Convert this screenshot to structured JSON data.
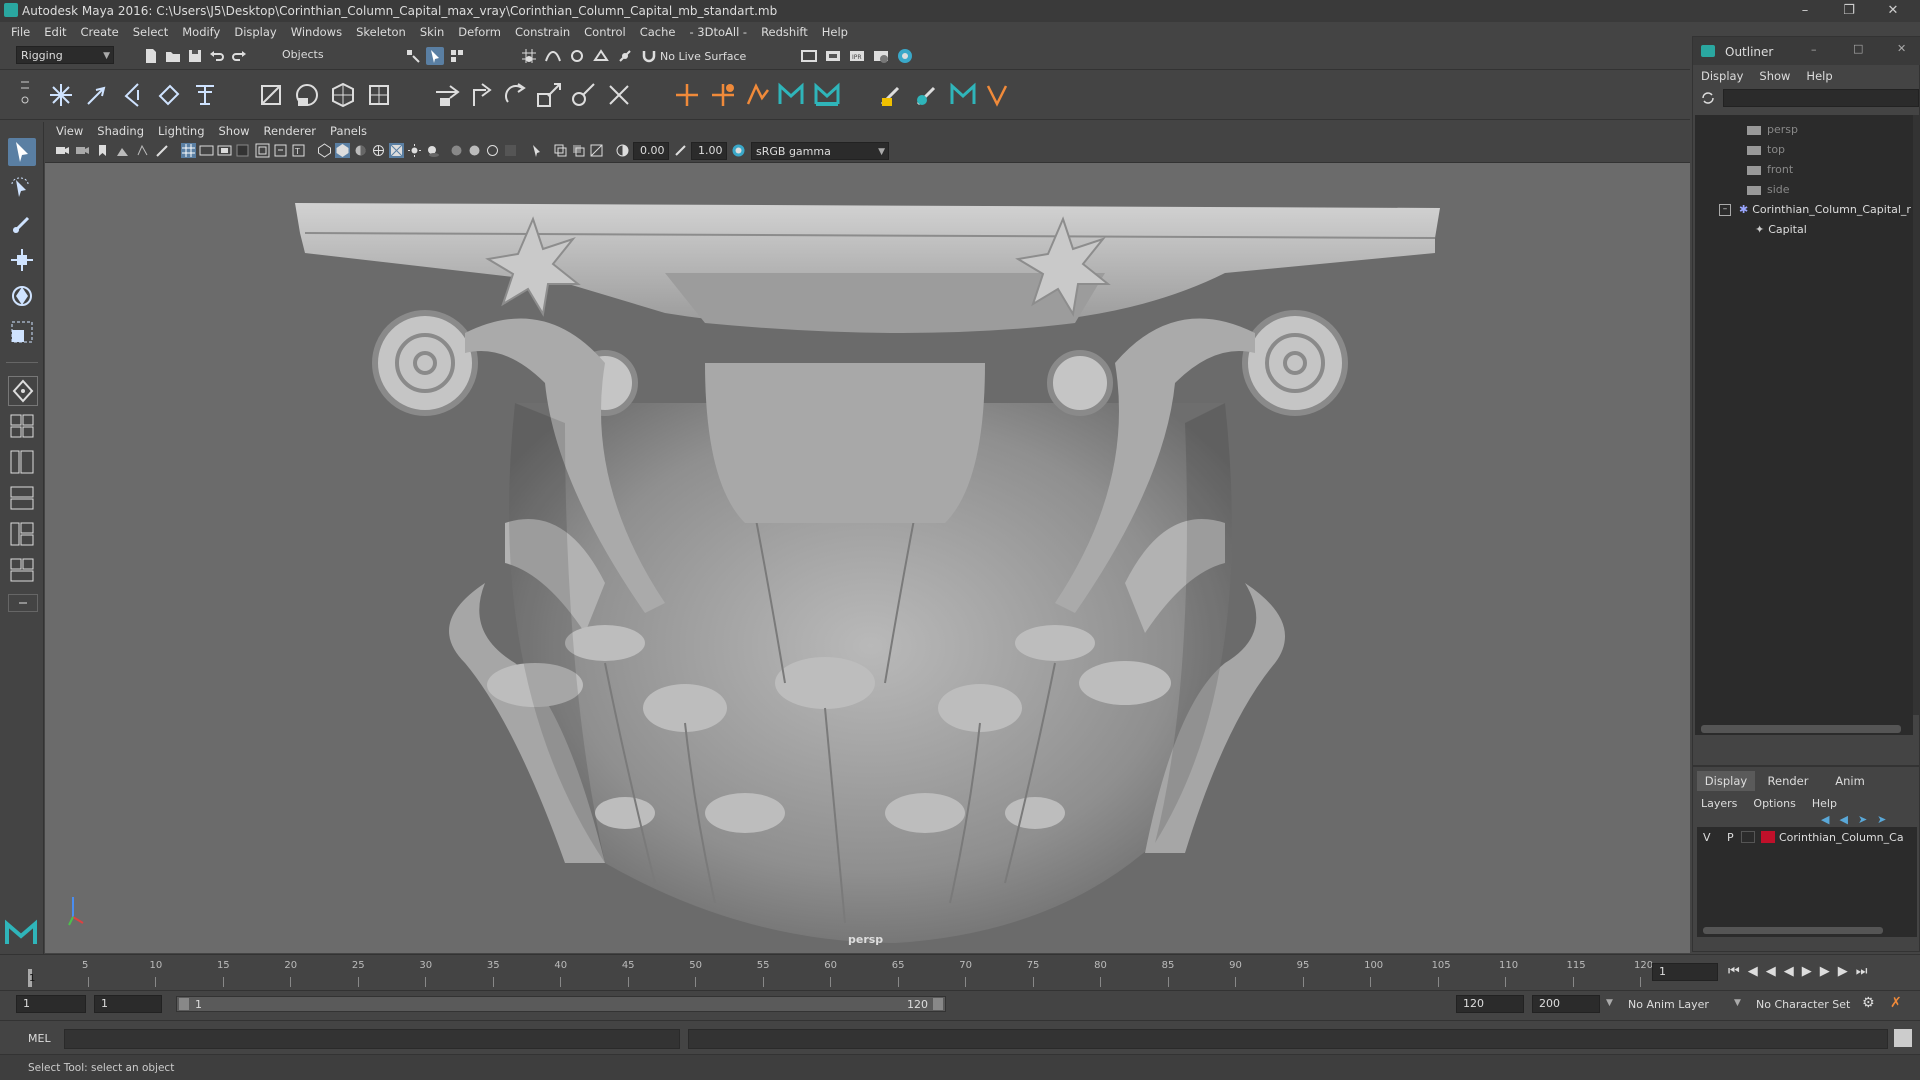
{
  "titlebar": {
    "title": "Autodesk Maya 2016: C:\\Users\\J5\\Desktop\\Corinthian_Column_Capital_max_vray\\Corinthian_Column_Capital_mb_standart.mb"
  },
  "menubar": {
    "items": [
      "File",
      "Edit",
      "Create",
      "Select",
      "Modify",
      "Display",
      "Windows",
      "Skeleton",
      "Skin",
      "Deform",
      "Constrain",
      "Control",
      "Cache",
      "- 3DtoAll -",
      "Redshift",
      "Help"
    ]
  },
  "statusline": {
    "mode": "Rigging",
    "selection_mode": "Objects",
    "live_surface": "No Live Surface"
  },
  "viewport": {
    "menu": [
      "View",
      "Shading",
      "Lighting",
      "Show",
      "Renderer",
      "Panels"
    ],
    "exposure": "0.00",
    "gamma": "1.00",
    "colorspace": "sRGB gamma",
    "camera_label": "persp"
  },
  "outliner": {
    "title": "Outliner",
    "menu": [
      "Display",
      "Show",
      "Help"
    ],
    "items": [
      {
        "label": "persp"
      },
      {
        "label": "top"
      },
      {
        "label": "front"
      },
      {
        "label": "side"
      },
      {
        "label": "Corinthian_Column_Capital_r"
      },
      {
        "label": "Capital"
      }
    ]
  },
  "layers": {
    "tabs": [
      "Display",
      "Render",
      "Anim"
    ],
    "menu": [
      "Layers",
      "Options",
      "Help"
    ],
    "row": {
      "v": "V",
      "p": "P",
      "name": "Corinthian_Column_Ca",
      "color": "#c0102a"
    }
  },
  "timeline": {
    "ticks": [
      "5",
      "10",
      "15",
      "20",
      "25",
      "30",
      "35",
      "40",
      "45",
      "50",
      "55",
      "60",
      "65",
      "70",
      "75",
      "80",
      "85",
      "90",
      "95",
      "100",
      "105",
      "110",
      "115",
      "120"
    ],
    "start_marker": "1",
    "current_frame": "1"
  },
  "range": {
    "start": "1",
    "anim_start": "1",
    "range_start_label": "1",
    "range_end_label": "120",
    "end": "120",
    "anim_end": "200",
    "anim_layer": "No Anim Layer",
    "character_set": "No Character Set"
  },
  "cmdline": {
    "label": "MEL"
  },
  "helpline": {
    "text": "Select Tool: select an object"
  }
}
